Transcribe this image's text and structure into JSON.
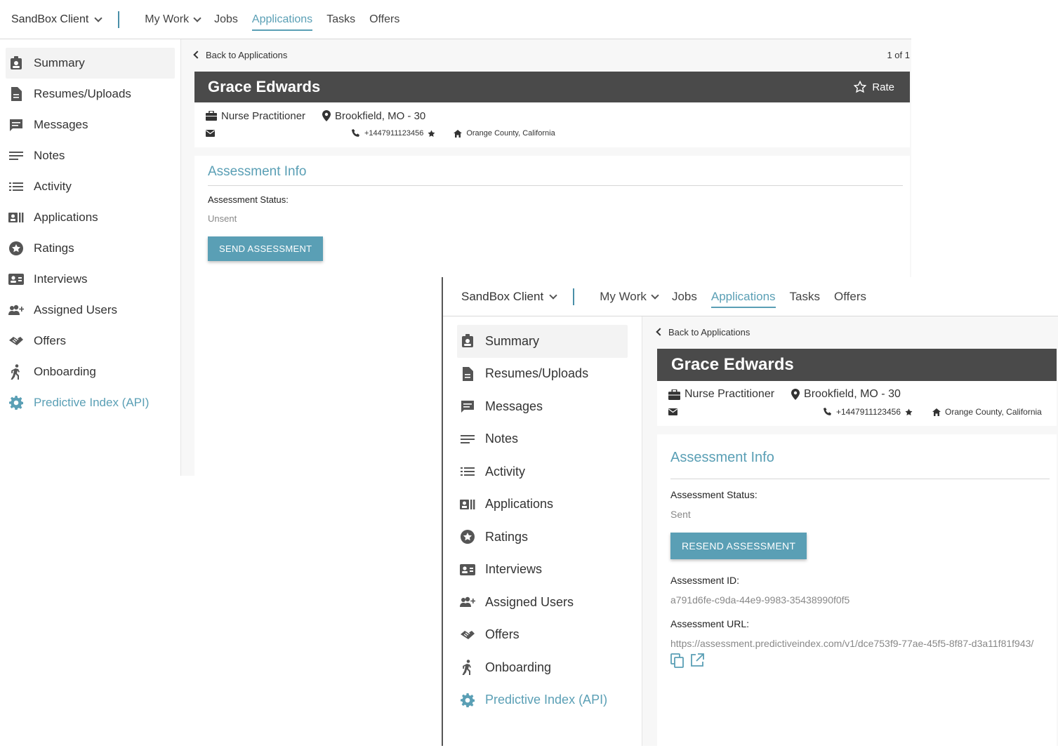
{
  "nav": {
    "client": "SandBox Client",
    "items": [
      "My Work",
      "Jobs",
      "Applications",
      "Tasks",
      "Offers"
    ],
    "active": "Applications"
  },
  "sidebar": {
    "items": [
      {
        "label": "Summary",
        "icon": "id-badge-icon"
      },
      {
        "label": "Resumes/Uploads",
        "icon": "document-icon"
      },
      {
        "label": "Messages",
        "icon": "message-icon"
      },
      {
        "label": "Notes",
        "icon": "notes-icon"
      },
      {
        "label": "Activity",
        "icon": "list-icon"
      },
      {
        "label": "Applications",
        "icon": "applications-icon"
      },
      {
        "label": "Ratings",
        "icon": "star-circle-icon"
      },
      {
        "label": "Interviews",
        "icon": "interview-icon"
      },
      {
        "label": "Assigned Users",
        "icon": "add-user-icon"
      },
      {
        "label": "Offers",
        "icon": "handshake-icon"
      },
      {
        "label": "Onboarding",
        "icon": "walking-icon"
      },
      {
        "label": "Predictive Index (API)",
        "icon": "gear-icon"
      }
    ]
  },
  "back_link": "Back to Applications",
  "pager": "1 of 1",
  "candidate": {
    "name": "Grace Edwards",
    "rate_label": "Rate",
    "title": "Nurse Practitioner",
    "location": "Brookfield, MO - 30",
    "phone": "+1447911123456",
    "address": "Orange County, California"
  },
  "assessment_before": {
    "card_title": "Assessment Info",
    "status_label": "Assessment Status:",
    "status_value": "Unsent",
    "button": "SEND ASSESSMENT"
  },
  "assessment_after": {
    "card_title": "Assessment Info",
    "status_label": "Assessment Status:",
    "status_value": "Sent",
    "button": "RESEND ASSESSMENT",
    "id_label": "Assessment ID:",
    "id_value": "a791d6fe-c9da-44e9-9983-35438990f0f5",
    "url_label": "Assessment URL:",
    "url_value": "https://assessment.predictiveindex.com/v1/dce753f9-77ae-45f5-8f87-d3a11f81f943/"
  },
  "colors": {
    "accent": "#5a9fb5",
    "namebar": "#4a4a4a"
  }
}
